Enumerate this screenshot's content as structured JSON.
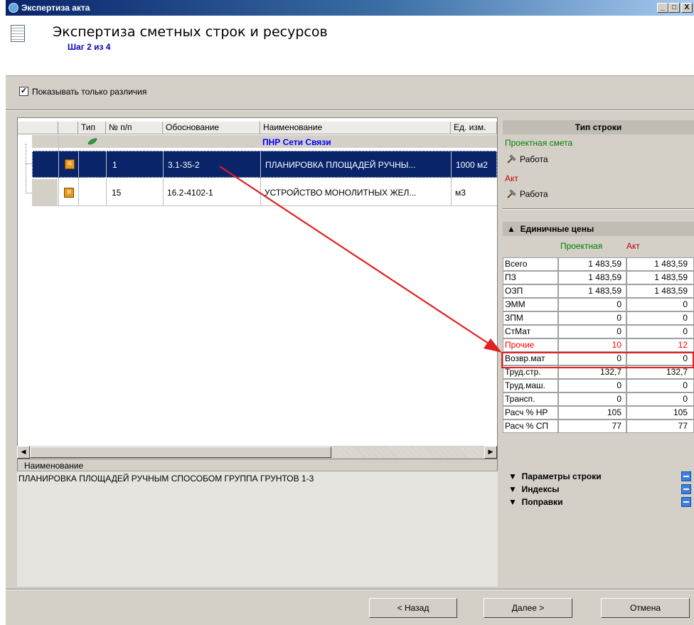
{
  "window": {
    "title": "Экспертиза акта",
    "min_glyph": "_",
    "max_glyph": "□",
    "close_glyph": "X"
  },
  "header": {
    "title": "Экспертиза сметных строк и ресурсов",
    "step": "Шаг 2 из 4"
  },
  "filter": {
    "checkbox_label": "Показывать только различия",
    "checked": true,
    "check_glyph": "✓"
  },
  "grid": {
    "columns": [
      "Тип",
      "№ п/п",
      "Обоснование",
      "Наименование",
      "Ед. изм."
    ],
    "group": "ПНР Сети Связи",
    "rows": [
      {
        "num": "1",
        "code": "3.1-35-2",
        "name": "ПЛАНИРОВКА ПЛОЩАДЕЙ РУЧНЫ...",
        "unit": "1000 м2",
        "selected": true
      },
      {
        "num": "15",
        "code": "16.2-4102-1",
        "name": "УСТРОЙСТВО МОНОЛИТНЫХ ЖЕЛ...",
        "unit": "м3",
        "selected": false
      }
    ],
    "row_icon_glyph": "≡"
  },
  "scroll": {
    "left_glyph": "◀",
    "right_glyph": "▶"
  },
  "detail": {
    "label": "Наименование",
    "text": "ПЛАНИРОВКА ПЛОЩАДЕЙ РУЧНЫМ СПОСОБОМ ГРУППА ГРУНТОВ 1-3"
  },
  "row_type": {
    "title": "Тип строки",
    "project_label": "Проектная смета",
    "project_value": "Работа",
    "act_label": "Акт",
    "act_value": "Работа"
  },
  "prices": {
    "title": "Единичные цены",
    "col_project": "Проектная",
    "col_act": "Акт",
    "rows": [
      {
        "label": "Всего",
        "project": "1 483,59",
        "act": "1 483,59"
      },
      {
        "label": "ПЗ",
        "project": "1 483,59",
        "act": "1 483,59"
      },
      {
        "label": "ОЗП",
        "project": "1 483,59",
        "act": "1 483,59"
      },
      {
        "label": "ЭММ",
        "project": "0",
        "act": "0"
      },
      {
        "label": "ЗПМ",
        "project": "0",
        "act": "0"
      },
      {
        "label": "СтМат",
        "project": "0",
        "act": "0"
      },
      {
        "label": "Прочие",
        "project": "10",
        "act": "12",
        "diff": true
      },
      {
        "label": "Возвр.мат",
        "project": "0",
        "act": "0"
      },
      {
        "label": "Труд.стр.",
        "project": "132,7",
        "act": "132,7"
      },
      {
        "label": "Труд.маш.",
        "project": "0",
        "act": "0"
      },
      {
        "label": "Трансп.",
        "project": "0",
        "act": "0"
      },
      {
        "label": "Расч % НР",
        "project": "105",
        "act": "105"
      },
      {
        "label": "Расч % СП",
        "project": "77",
        "act": "77"
      }
    ]
  },
  "sections": [
    {
      "label": "Параметры строки"
    },
    {
      "label": "Индексы"
    },
    {
      "label": "Поправки"
    }
  ],
  "buttons": {
    "back": "< Назад",
    "next": "Далее >",
    "cancel": "Отмена"
  },
  "colors": {
    "diff": "#ff0000",
    "selection": "#0a246a",
    "green": "#008000",
    "link": "#0000ff"
  }
}
